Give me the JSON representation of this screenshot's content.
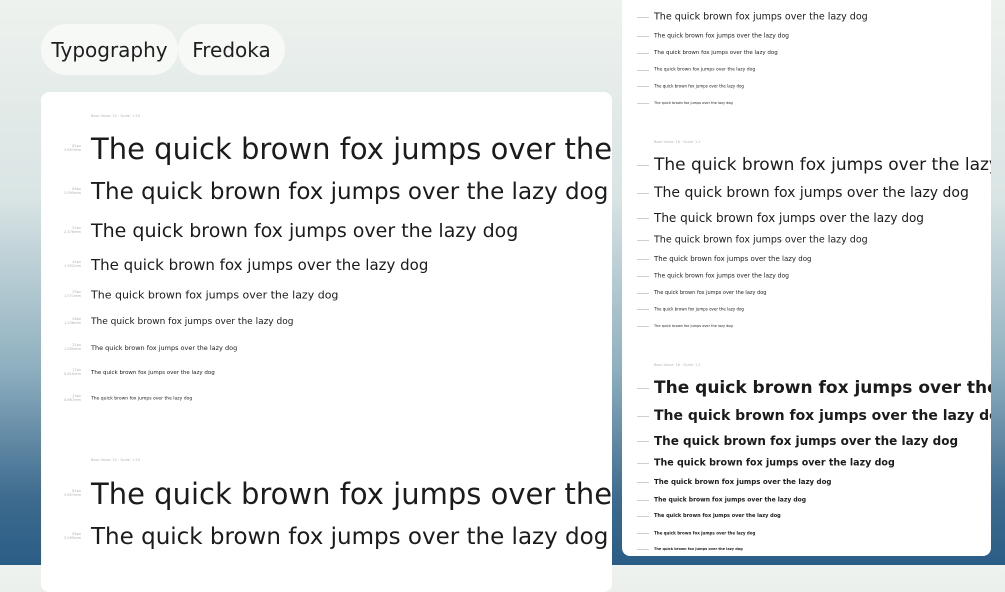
{
  "header": {
    "tab_typography": "Typography",
    "tab_font": "Fredoka"
  },
  "main_card": {
    "sections": [
      {
        "meta": "Base Value: 21 · Scale: 1.24",
        "rows": [
          {
            "size": "81px",
            "sub": "3.857rem",
            "sample": "The quick brown fox jumps over the lazy dog"
          },
          {
            "size": "65px",
            "sub": "3.095rem",
            "sample": "The quick brown fox jumps over the lazy dog"
          },
          {
            "size": "52px",
            "sub": "2.476rem",
            "sample": "The quick brown fox jumps over the lazy dog"
          },
          {
            "size": "41px",
            "sub": "1.952rem",
            "sample": "The quick brown fox jumps over the lazy dog"
          },
          {
            "size": "33px",
            "sub": "1.571rem",
            "sample": "The quick brown fox jumps over the lazy dog"
          },
          {
            "size": "26px",
            "sub": "1.238rem",
            "sample": "The quick brown fox jumps over the lazy dog"
          },
          {
            "size": "21px",
            "sub": "1.000rem",
            "sample": "The quick brown fox jumps over the lazy dog"
          },
          {
            "size": "17px",
            "sub": "0.810rem",
            "sample": "The quick brown fox jumps over the lazy dog"
          },
          {
            "size": "14px",
            "sub": "0.667rem",
            "sample": "The quick brown fox jumps over the lazy dog"
          }
        ]
      },
      {
        "meta": "Base Value: 21 · Scale: 1.24",
        "rows": [
          {
            "size": "81px",
            "sub": "3.857rem",
            "sample": "The quick brown fox jumps over the lazy dog"
          },
          {
            "size": "65px",
            "sub": "3.095rem",
            "sample": "The quick brown fox jumps over the lazy dog"
          }
        ]
      }
    ]
  },
  "side_card": {
    "sections": [
      {
        "meta": "",
        "rows": [
          {
            "sample": "The quick brown fox jumps over the lazy dog"
          },
          {
            "sample": "The quick brown fox jumps over the lazy dog"
          },
          {
            "sample": "The quick brown fox jumps over the lazy dog"
          },
          {
            "sample": "The quick brown fox jumps over the lazy dog"
          },
          {
            "sample": "The quick brown fox jumps over the lazy dog"
          },
          {
            "sample": "The quick brown fox jumps over the lazy dog"
          }
        ]
      },
      {
        "meta": "Base Value: 16 · Scale: 1.2",
        "rows": [
          {
            "sample": "The quick brown fox jumps over the lazy dog"
          },
          {
            "sample": "The quick brown fox jumps over the lazy dog"
          },
          {
            "sample": "The quick brown fox jumps over the lazy dog"
          },
          {
            "sample": "The quick brown fox jumps over the lazy dog"
          },
          {
            "sample": "The quick brown fox jumps over the lazy dog"
          },
          {
            "sample": "The quick brown fox jumps over the lazy dog"
          },
          {
            "sample": "The quick brown fox jumps over the lazy dog"
          },
          {
            "sample": "The quick brown fox jumps over the lazy dog"
          },
          {
            "sample": "The quick brown fox jumps over the lazy dog"
          }
        ]
      },
      {
        "meta": "Base Value: 16 · Scale: 1.2",
        "rows": [
          {
            "sample": "The quick brown fox jumps over the lazy dog"
          },
          {
            "sample": "The quick brown fox jumps over the lazy dog"
          },
          {
            "sample": "The quick brown fox jumps over the lazy dog"
          },
          {
            "sample": "The quick brown fox jumps over the lazy dog"
          },
          {
            "sample": "The quick brown fox jumps over the lazy dog"
          },
          {
            "sample": "The quick brown fox jumps over the lazy dog"
          },
          {
            "sample": "The quick brown fox jumps over the lazy dog"
          },
          {
            "sample": "The quick brown fox jumps over the lazy dog"
          },
          {
            "sample": "The quick brown fox jumps over the lazy dog"
          }
        ]
      }
    ]
  }
}
